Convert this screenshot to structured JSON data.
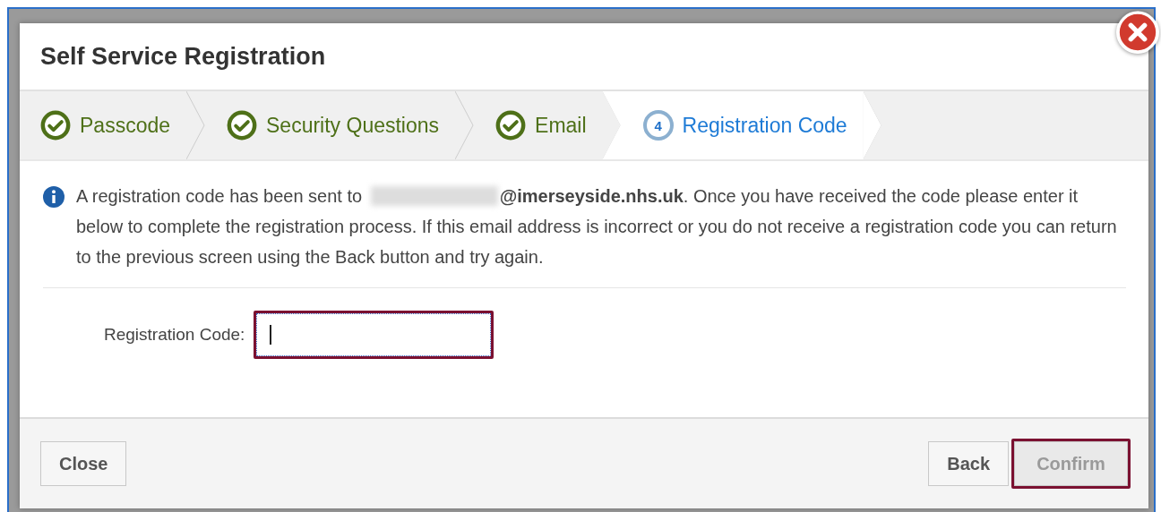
{
  "dialog": {
    "title": "Self Service Registration"
  },
  "steps": [
    {
      "label": "Passcode",
      "kind": "done",
      "selected": false
    },
    {
      "label": "Security Questions",
      "kind": "done",
      "selected": false
    },
    {
      "label": "Email",
      "kind": "done",
      "selected": false
    },
    {
      "label": "Registration Code",
      "kind": "current",
      "number": "4",
      "selected": true
    }
  ],
  "message": {
    "before": "A registration code has been sent to",
    "after": "**@imerseyside.nhs.uk**. Once you have received the code please enter it below to complete the registration process. If this email address is incorrect or you do not receive a registration code you can return to the previous screen using the Back button and try again."
  },
  "field": {
    "label": "Registration Code:",
    "highlighted": true
  },
  "footer": {
    "left_buttons": [
      {
        "label": "Close",
        "disabled": false,
        "highlighted": false
      }
    ],
    "right_buttons": [
      {
        "label": "Back",
        "disabled": false,
        "highlighted": false
      },
      {
        "label": "Confirm",
        "disabled": true,
        "highlighted": true
      }
    ]
  }
}
